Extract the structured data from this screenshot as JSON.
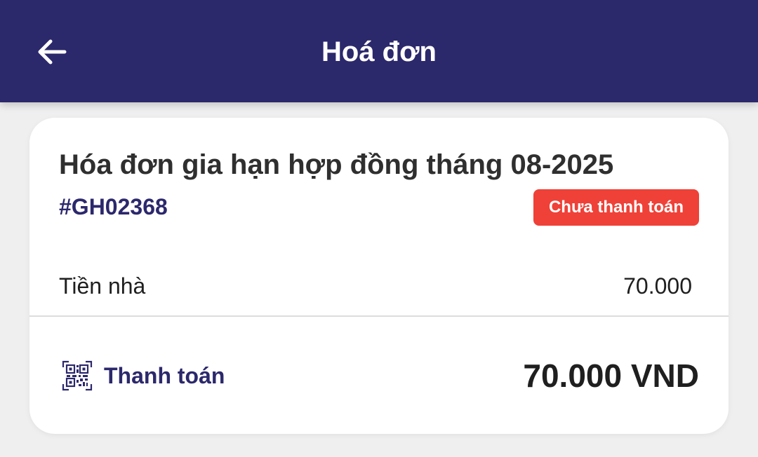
{
  "header": {
    "title": "Hoá đơn",
    "back_icon": "arrow-left-icon",
    "background_color": "#2c286c"
  },
  "invoice": {
    "title": "Hóa đơn gia hạn hợp đồng tháng 08-2025",
    "code": "#GH02368",
    "status": "Chưa thanh toán",
    "status_color": "#ef4138",
    "items": [
      {
        "label": "Tiền nhà",
        "amount": "70.000"
      }
    ],
    "payment": {
      "label": "Thanh toán",
      "icon": "qr-code-icon",
      "total": "70.000 VND"
    }
  }
}
